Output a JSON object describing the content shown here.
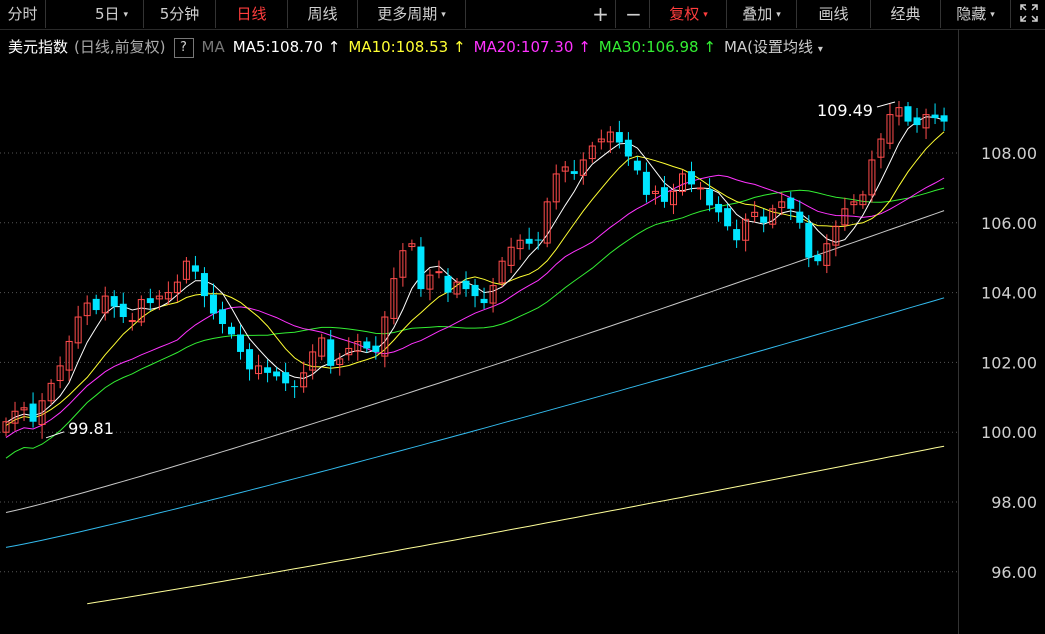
{
  "toolbar": {
    "tabs": [
      {
        "label": "分时"
      },
      {
        "label": "5日",
        "caret": "▾"
      },
      {
        "label": "5分钟"
      },
      {
        "label": "日线",
        "active": true
      },
      {
        "label": "周线"
      },
      {
        "label": "更多周期",
        "caret": "▾"
      }
    ],
    "plus_label": "+",
    "minus_label": "−",
    "right": [
      {
        "label": "复权",
        "caret": "▾",
        "active": true
      },
      {
        "label": "叠加",
        "caret": "▾"
      },
      {
        "label": "画线"
      },
      {
        "label": "经典"
      },
      {
        "label": "隐藏",
        "caret": "▾"
      }
    ],
    "fullscreen_icon": "expand-icon"
  },
  "legend": {
    "name": "美元指数",
    "mode": "(日线,前复权)",
    "help": "?",
    "ma_label": "MA",
    "ma5": "MA5:108.70",
    "ma10": "MA10:108.53",
    "ma20": "MA20:107.30",
    "ma30": "MA30:106.98",
    "more": "MA(",
    "settings": "设置均线",
    "settings_caret": "▾",
    "up_arrow": "↑"
  },
  "colors": {
    "bg": "#000000",
    "up": "#ff4c4c",
    "down": "#00e5ff",
    "grid": "#555555",
    "axis_text": "#cfcfcf",
    "ma5": "#ffffff",
    "ma10": "#ffff33",
    "ma20": "#ff33ff",
    "ma30": "#33ee33",
    "ma60": "#c8c8c8",
    "ma120": "#33bbee",
    "ma250": "#ffff99"
  },
  "chart_data": {
    "type": "candlestick",
    "yticks": [
      "108.00",
      "106.00",
      "104.00",
      "102.00",
      "100.00",
      "98.00",
      "96.00"
    ],
    "ylim": [
      94.6,
      110.7
    ],
    "grid": "horizontal-dotted",
    "annotations": [
      {
        "text": "109.49",
        "value": 109.49
      },
      {
        "text": "99.81",
        "value": 99.81
      }
    ],
    "closes": [
      100.3,
      100.6,
      100.7,
      100.3,
      100.9,
      101.4,
      101.9,
      102.6,
      103.3,
      103.7,
      103.5,
      103.9,
      103.6,
      103.3,
      103.2,
      103.8,
      103.7,
      103.9,
      104.0,
      104.3,
      104.9,
      104.6,
      103.9,
      103.4,
      103.1,
      102.8,
      102.3,
      101.8,
      101.9,
      101.7,
      101.6,
      101.4,
      101.3,
      101.7,
      102.3,
      102.7,
      101.9,
      102.1,
      102.4,
      102.6,
      102.4,
      102.3,
      103.3,
      104.4,
      105.2,
      105.4,
      104.1,
      104.5,
      104.6,
      104.0,
      104.3,
      104.1,
      103.9,
      103.7,
      104.2,
      104.9,
      105.3,
      105.5,
      105.4,
      105.5,
      106.6,
      107.4,
      107.6,
      107.4,
      107.8,
      108.2,
      108.4,
      108.6,
      108.3,
      107.9,
      107.5,
      106.8,
      106.9,
      106.6,
      106.9,
      107.4,
      107.1,
      107.0,
      106.5,
      106.3,
      105.9,
      105.5,
      106.1,
      106.3,
      106.0,
      106.4,
      106.6,
      106.4,
      106.0,
      105.0,
      104.9,
      105.4,
      105.9,
      106.4,
      106.6,
      106.8,
      107.8,
      108.4,
      109.1,
      109.3,
      108.9,
      108.8,
      109.1,
      109.0,
      108.9
    ],
    "ma60_end": 106.35,
    "ma120_end": 103.85,
    "ma250_end": 99.6,
    "ma60_start": 97.7,
    "ma120_start": 96.7,
    "ma250_start": 94.75
  }
}
